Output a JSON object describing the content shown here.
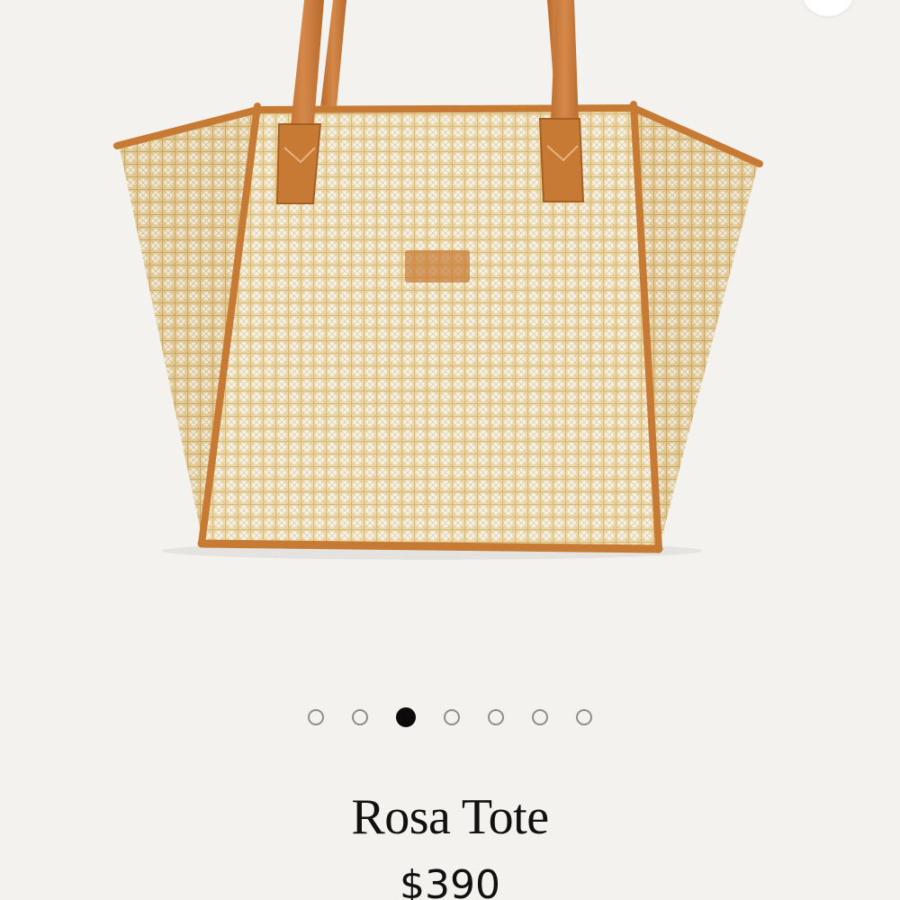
{
  "product": {
    "name": "Rosa Tote",
    "price": "$390"
  },
  "image": {
    "icon": "rattan-tote-bag-image",
    "colors": {
      "cane": "#ecd9ac",
      "cane_dark": "#caa66a",
      "leather": "#c77a34",
      "background": "#f4f2ee"
    }
  },
  "carousel": {
    "total": 7,
    "active_index": 2,
    "active_color": "#0b0b0b",
    "inactive_color": "#8e8e8e"
  }
}
